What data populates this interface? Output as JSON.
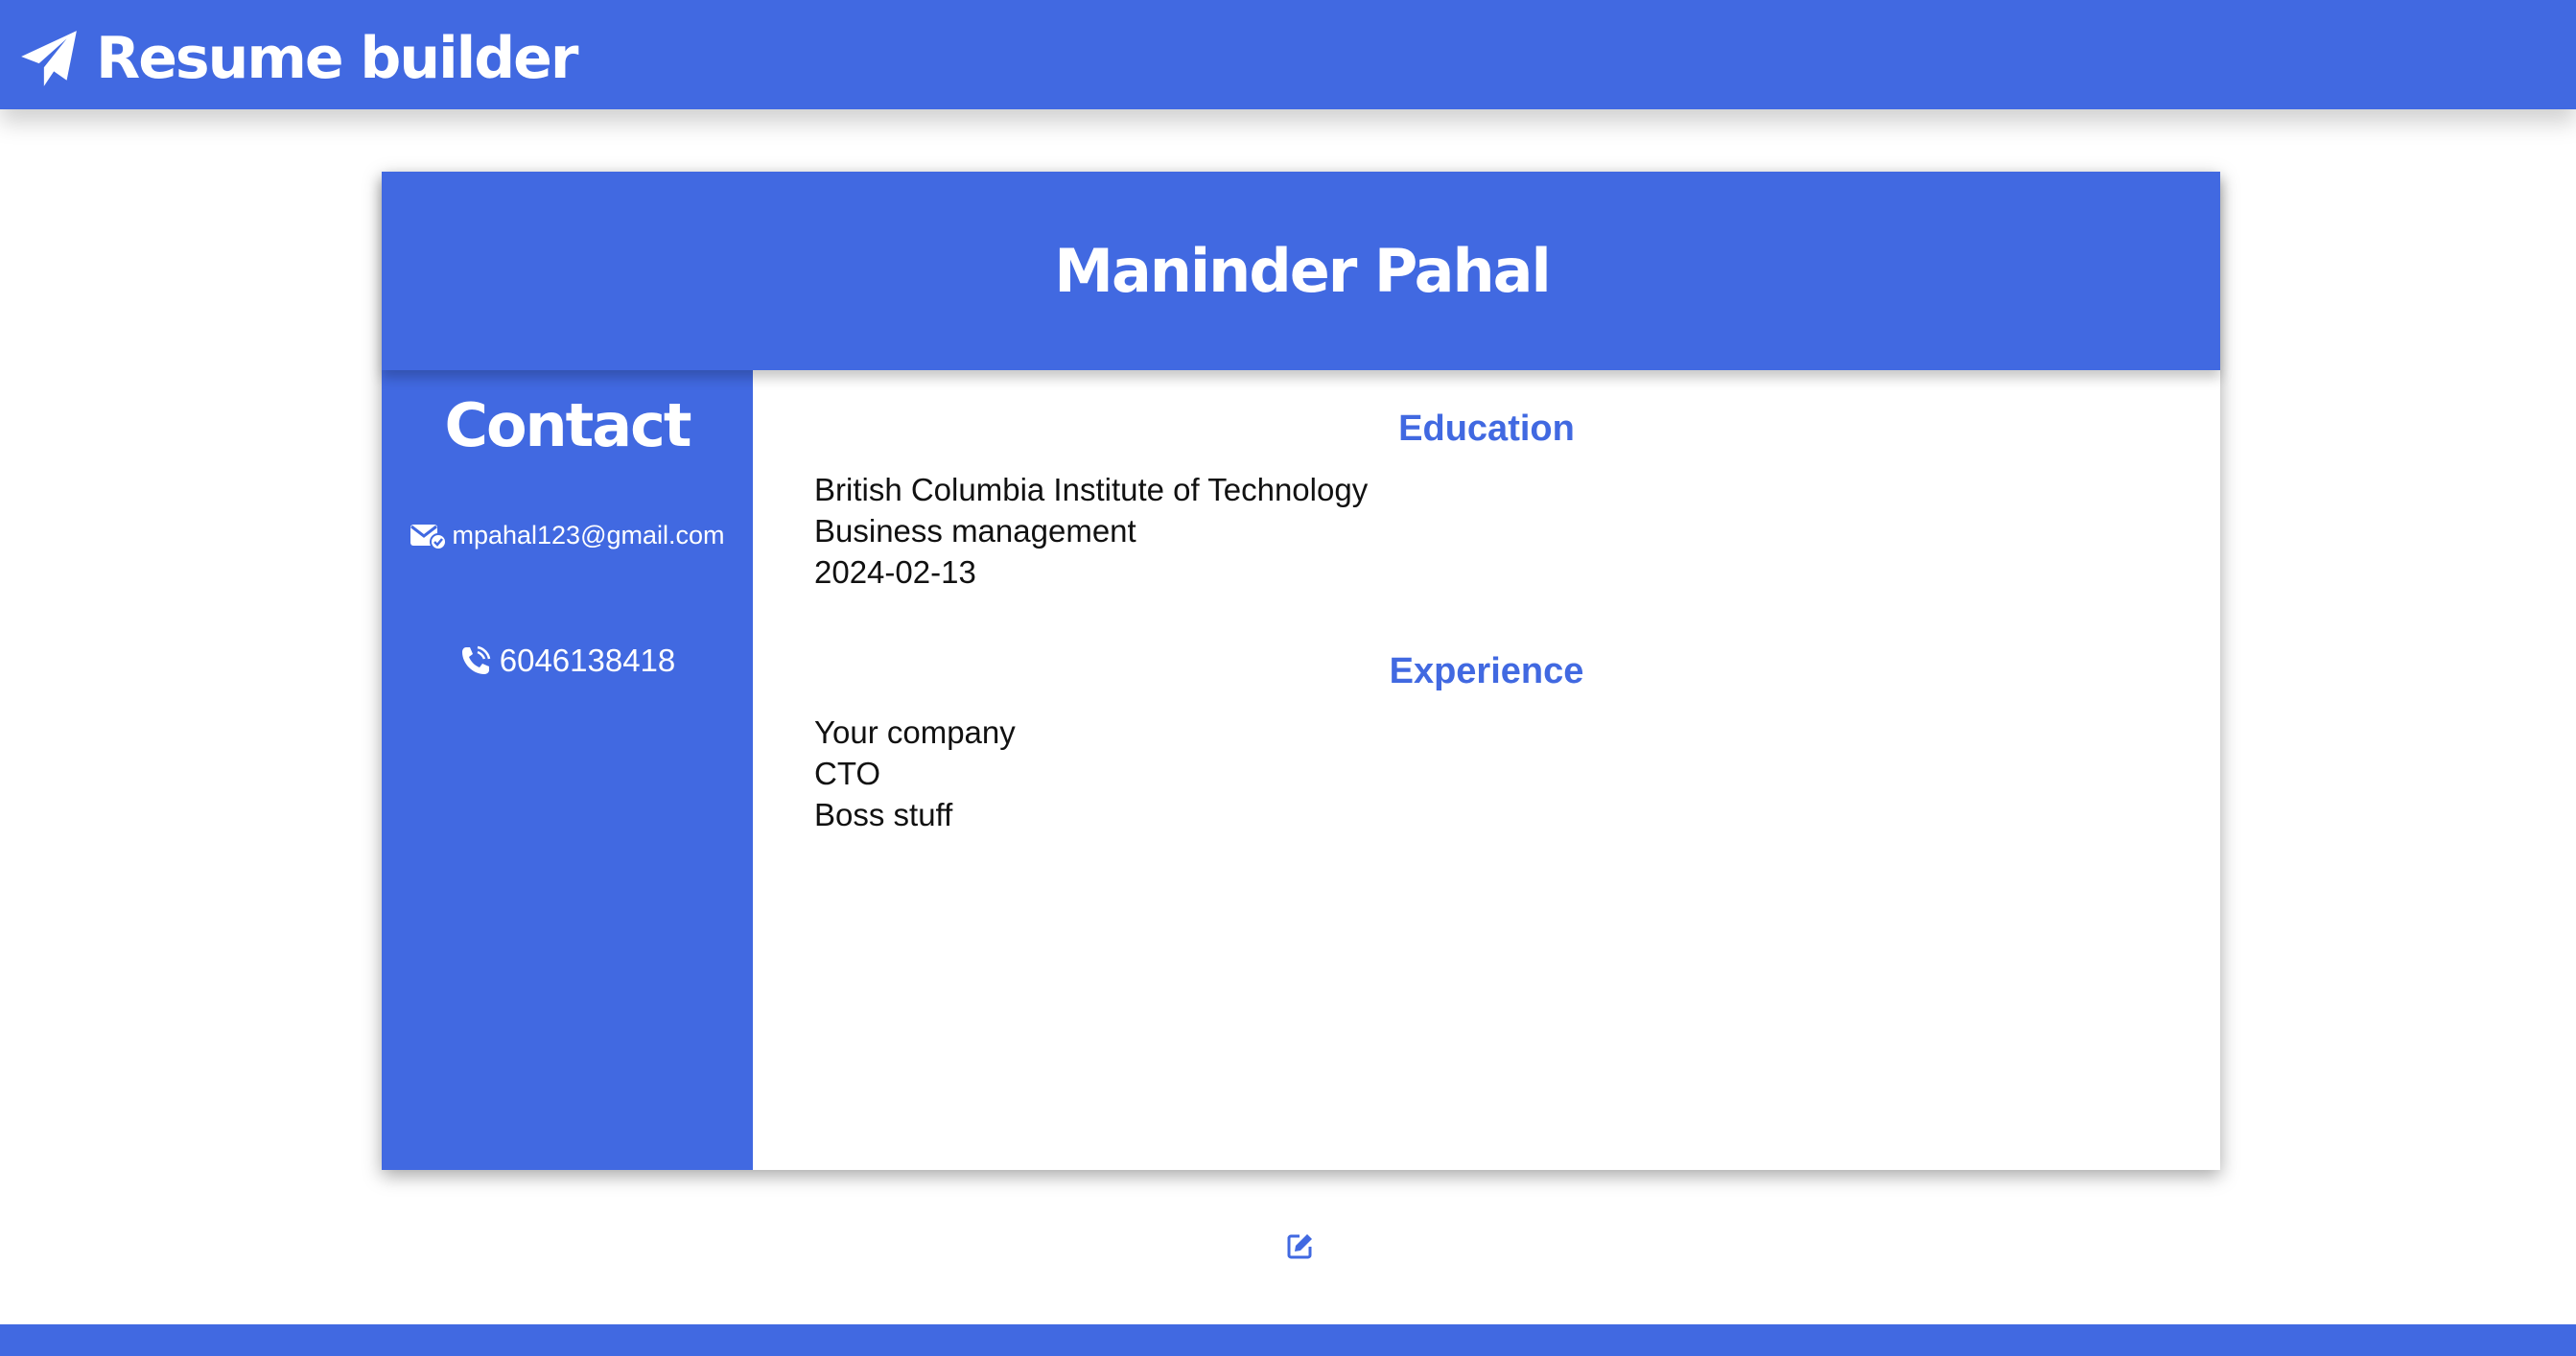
{
  "header": {
    "brand_title": "Resume builder",
    "brand_icon": "paper-plane-icon"
  },
  "resume": {
    "name": "Maninder Pahal",
    "contact": {
      "heading": "Contact",
      "email": "mpahal123@gmail.com",
      "email_icon": "envelope-check-icon",
      "phone": "6046138418",
      "phone_icon": "phone-volume-icon"
    },
    "education": {
      "heading": "Education",
      "institution": "British Columbia Institute of Technology",
      "program": "Business management",
      "date": "2024-02-13"
    },
    "experience": {
      "heading": "Experience",
      "company": "Your company",
      "role": "CTO",
      "description": "Boss stuff"
    }
  },
  "actions": {
    "edit_icon": "edit-icon"
  },
  "colors": {
    "primary": "#4169e1",
    "text": "#111111",
    "background": "#ffffff"
  }
}
